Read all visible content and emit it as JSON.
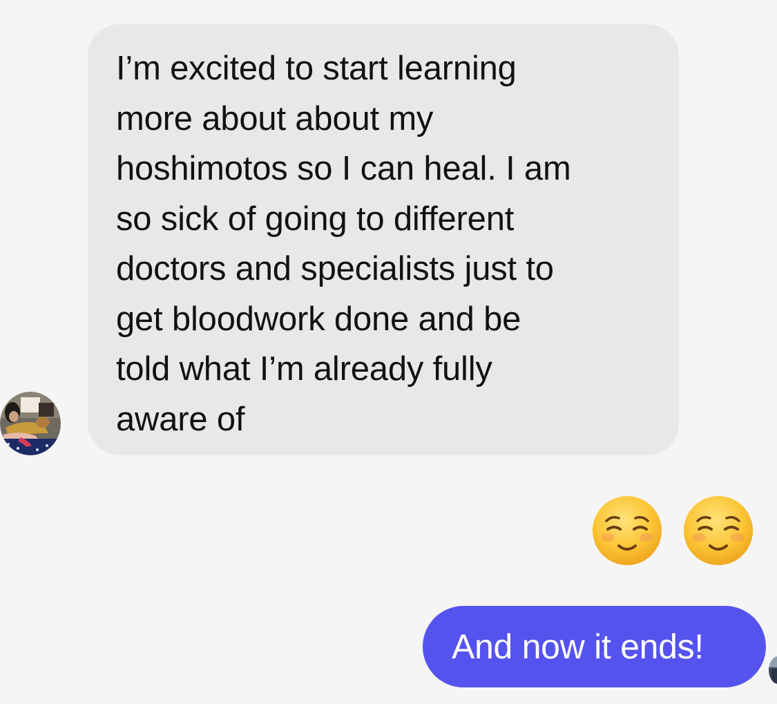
{
  "conversation": {
    "incoming_message": {
      "text": "I’m excited to start learning\nmore about about my\nhoshimotos so I can heal.  I am\nso sick of going to different\ndoctors and specialists just to\nget bloodwork done and be\ntold what I’m already fully\naware of",
      "bubble_color": "#e8e8e8",
      "text_color": "#111111"
    },
    "reactions": [
      "☺️",
      "☺️"
    ],
    "outgoing_message": {
      "text": "And now it ends!",
      "bubble_color": "#5553ee",
      "text_color": "#ffffff"
    }
  },
  "icons": {
    "sender_avatar": "avatar-photo",
    "recipient_avatar": "avatar-photo",
    "reaction": "smiling-face-emoji"
  },
  "colors": {
    "background": "#f5f5f5",
    "accent": "#5553ee"
  }
}
